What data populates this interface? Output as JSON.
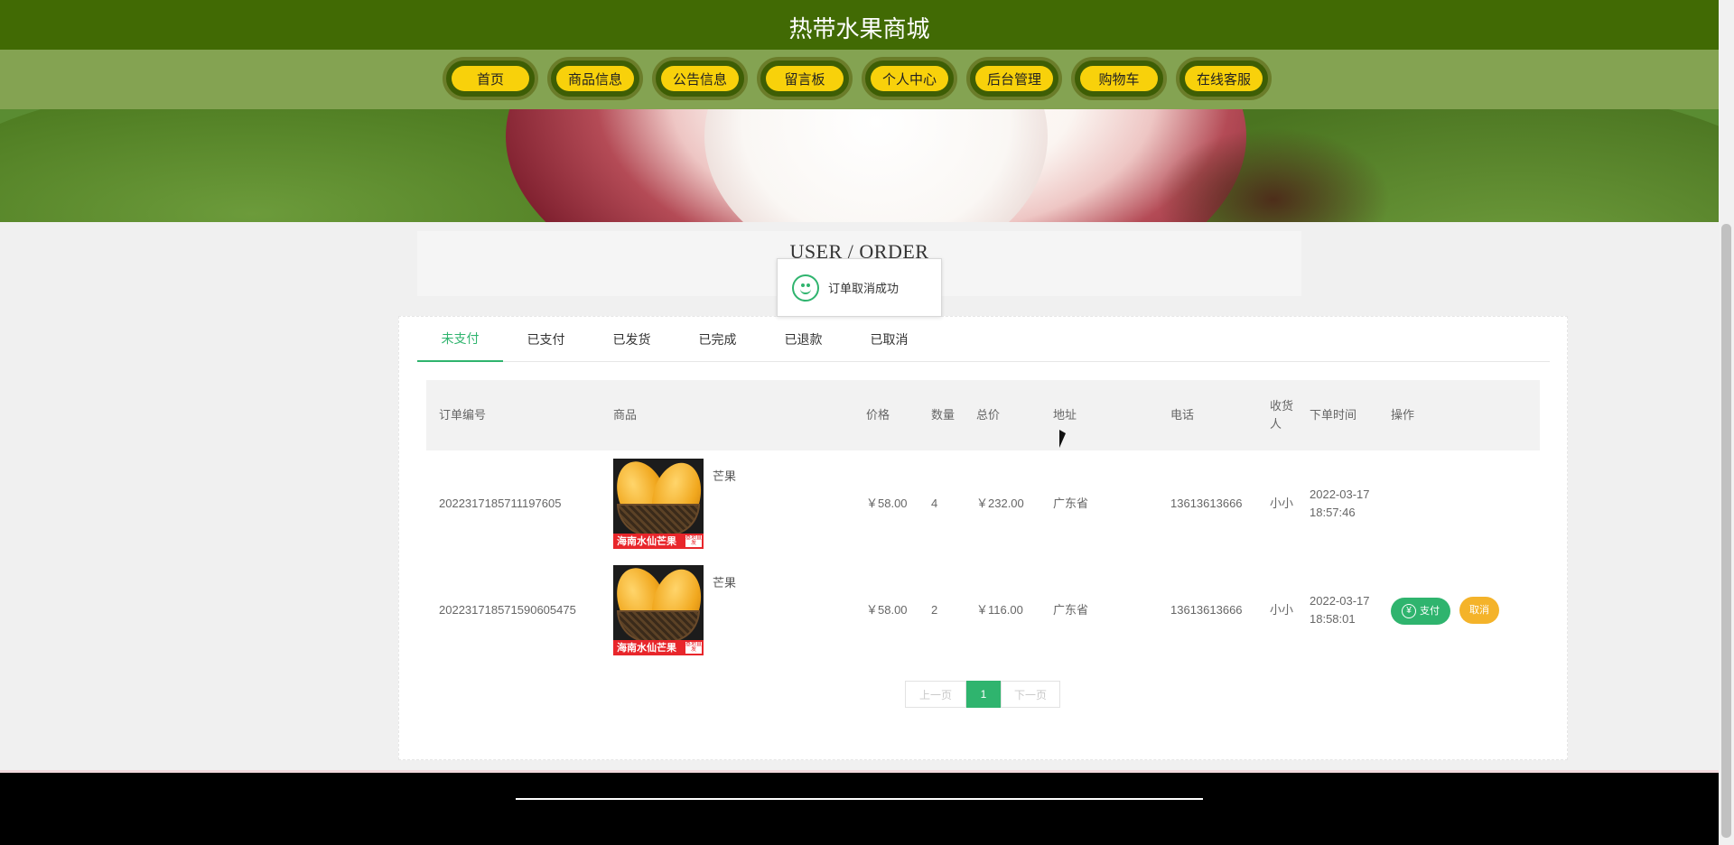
{
  "site": {
    "title": "热带水果商城"
  },
  "nav": {
    "items": [
      {
        "label": "首页"
      },
      {
        "label": "商品信息"
      },
      {
        "label": "公告信息"
      },
      {
        "label": "留言板"
      },
      {
        "label": "个人中心"
      },
      {
        "label": "后台管理"
      },
      {
        "label": "购物车"
      },
      {
        "label": "在线客服"
      }
    ]
  },
  "banner": {
    "active_slide": 2,
    "slide_count": 3
  },
  "section": {
    "title": "USER / ORDER"
  },
  "toast": {
    "message": "订单取消成功",
    "icon": "smile-icon"
  },
  "tabs": [
    {
      "label": "未支付",
      "active": true
    },
    {
      "label": "已支付",
      "active": false
    },
    {
      "label": "已发货",
      "active": false
    },
    {
      "label": "已完成",
      "active": false
    },
    {
      "label": "已退款",
      "active": false
    },
    {
      "label": "已取消",
      "active": false
    }
  ],
  "table": {
    "headers": {
      "order_no": "订单编号",
      "goods": "商品",
      "price": "价格",
      "qty": "数量",
      "total": "总价",
      "address": "地址",
      "phone": "电话",
      "receiver": "收货人",
      "time": "下单时间",
      "action": "操作"
    },
    "rows": [
      {
        "order_no": "2022317185711197605",
        "goods_name": "芒果",
        "image_caption": "海南水仙芒果",
        "image_tag": "基地直发",
        "price": "￥58.00",
        "qty": "4",
        "total": "￥232.00",
        "address": "广东省",
        "phone": "13613613666",
        "receiver": "小小",
        "time": "2022-03-17 18:57:46",
        "show_actions": false
      },
      {
        "order_no": "20223171857159060547​5",
        "goods_name": "芒果",
        "image_caption": "海南水仙芒果",
        "image_tag": "基地直发",
        "price": "￥58.00",
        "qty": "2",
        "total": "￥116.00",
        "address": "广东省",
        "phone": "13613613666",
        "receiver": "小小",
        "time": "2022-03-17 18:58:01",
        "show_actions": true
      }
    ],
    "actions": {
      "pay": "支付",
      "pay_icon": "yen-icon",
      "cancel": "取消"
    }
  },
  "pager": {
    "prev": "上一页",
    "current": "1",
    "next": "下一页"
  },
  "colors": {
    "header": "#416a04",
    "nav": "#84a352",
    "nav_button": "#f8d10b",
    "accent": "#2fb46e",
    "cancel": "#f4b32a",
    "footer": "#000000"
  }
}
